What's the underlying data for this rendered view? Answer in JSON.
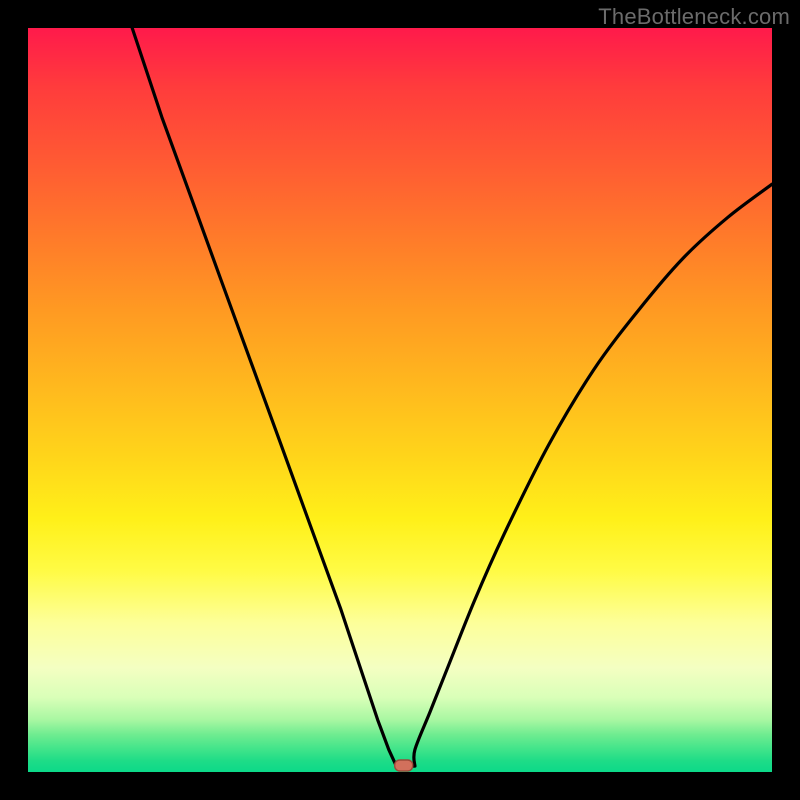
{
  "watermark": "TheBottleneck.com",
  "colors": {
    "frame": "#000000",
    "curve": "#000000",
    "marker_fill": "#d2705c",
    "marker_stroke": "#9c4a3a"
  },
  "chart_data": {
    "type": "line",
    "title": "",
    "xlabel": "",
    "ylabel": "",
    "xlim": [
      0,
      100
    ],
    "ylim": [
      0,
      100
    ],
    "grid": false,
    "legend": false,
    "series": [
      {
        "name": "bottleneck-curve",
        "x": [
          14,
          18,
          22,
          26,
          30,
          34,
          38,
          42,
          45,
          47,
          48.5,
          49.5,
          50.5,
          52,
          54,
          56,
          60,
          64,
          70,
          76,
          82,
          88,
          94,
          100
        ],
        "y": [
          100,
          88,
          77,
          66,
          55,
          44,
          33,
          22,
          13,
          7,
          3,
          0.8,
          0.6,
          3,
          8,
          13,
          23,
          32,
          44,
          54,
          62,
          69,
          74.5,
          79
        ]
      }
    ],
    "annotations": [
      {
        "type": "marker",
        "shape": "rounded-rect",
        "x": 50.5,
        "y": 0.5,
        "label": "optimal-point"
      }
    ]
  }
}
